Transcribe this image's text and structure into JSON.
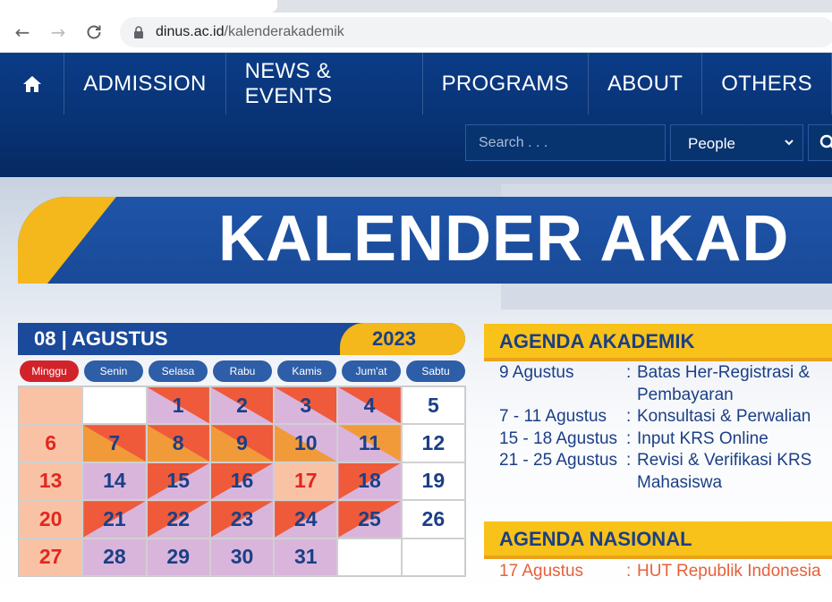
{
  "browser": {
    "url_host": "dinus.ac.id",
    "url_path": "/kalenderakademik"
  },
  "nav": {
    "home_icon": "home-icon",
    "items": [
      "ADMISSION",
      "NEWS & EVENTS",
      "PROGRAMS",
      "ABOUT",
      "OTHERS"
    ]
  },
  "search": {
    "placeholder": "Search . . .",
    "category": "People"
  },
  "banner": {
    "title": "KALENDER AKAD"
  },
  "calendar": {
    "month": "08 | AGUSTUS",
    "year": "2023",
    "days": [
      "Minggu",
      "Senin",
      "Selasa",
      "Rabu",
      "Kamis",
      "Jum'at",
      "Sabtu"
    ],
    "weeks": [
      [
        "",
        "",
        "1",
        "2",
        "3",
        "4",
        "5"
      ],
      [
        "6",
        "7",
        "8",
        "9",
        "10",
        "11",
        "12"
      ],
      [
        "13",
        "14",
        "15",
        "16",
        "17",
        "18",
        "19"
      ],
      [
        "20",
        "21",
        "22",
        "23",
        "24",
        "25",
        "26"
      ],
      [
        "27",
        "28",
        "29",
        "30",
        "31",
        "",
        ""
      ]
    ]
  },
  "agenda_akademik": {
    "title": "AGENDA AKADEMIK",
    "rows": [
      {
        "date": "9 Agustus",
        "colon": ":",
        "text": "Batas Her-Registrasi & Pembayaran"
      },
      {
        "date": "7 - 11 Agustus",
        "colon": ":",
        "text": "Konsultasi & Perwalian"
      },
      {
        "date": "15 - 18 Agustus",
        "colon": ":",
        "text": "Input KRS Online"
      },
      {
        "date": "21 - 25 Agustus",
        "colon": ":",
        "text": "Revisi & Verifikasi KRS Mahasiswa"
      }
    ]
  },
  "agenda_nasional": {
    "title": "AGENDA NASIONAL",
    "rows": [
      {
        "date": "17 Agustus",
        "colon": ":",
        "text": "HUT Republik Indonesia"
      }
    ]
  },
  "colors": {
    "header_blue": "#0b3c87",
    "accent_yellow": "#f4b71c",
    "calendar_navy": "#1b3f86",
    "holiday_red": "#e2271f"
  }
}
